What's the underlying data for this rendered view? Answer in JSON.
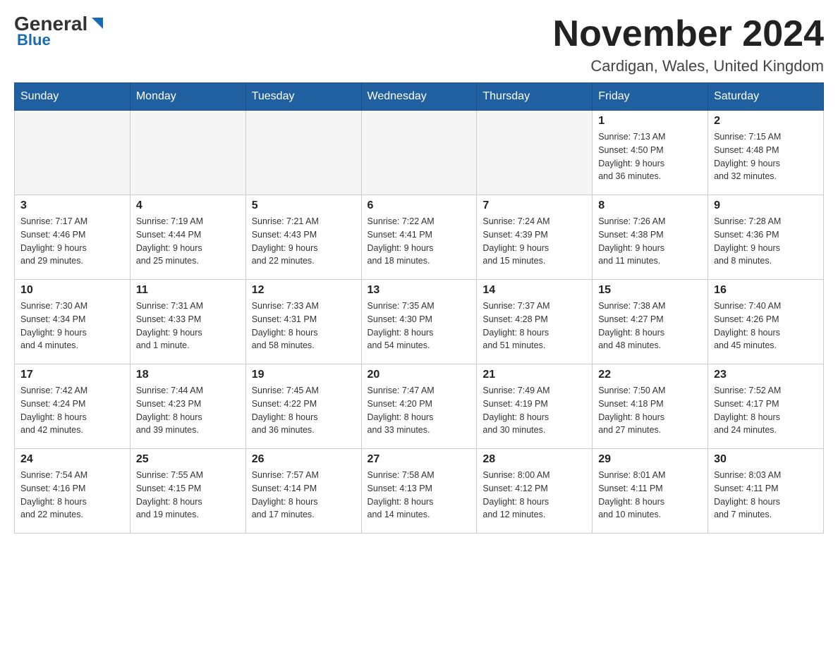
{
  "header": {
    "logo_general": "General",
    "logo_blue": "Blue",
    "month_title": "November 2024",
    "location": "Cardigan, Wales, United Kingdom"
  },
  "days_of_week": [
    "Sunday",
    "Monday",
    "Tuesday",
    "Wednesday",
    "Thursday",
    "Friday",
    "Saturday"
  ],
  "weeks": [
    {
      "days": [
        {
          "date": "",
          "info": ""
        },
        {
          "date": "",
          "info": ""
        },
        {
          "date": "",
          "info": ""
        },
        {
          "date": "",
          "info": ""
        },
        {
          "date": "",
          "info": ""
        },
        {
          "date": "1",
          "info": "Sunrise: 7:13 AM\nSunset: 4:50 PM\nDaylight: 9 hours\nand 36 minutes."
        },
        {
          "date": "2",
          "info": "Sunrise: 7:15 AM\nSunset: 4:48 PM\nDaylight: 9 hours\nand 32 minutes."
        }
      ]
    },
    {
      "days": [
        {
          "date": "3",
          "info": "Sunrise: 7:17 AM\nSunset: 4:46 PM\nDaylight: 9 hours\nand 29 minutes."
        },
        {
          "date": "4",
          "info": "Sunrise: 7:19 AM\nSunset: 4:44 PM\nDaylight: 9 hours\nand 25 minutes."
        },
        {
          "date": "5",
          "info": "Sunrise: 7:21 AM\nSunset: 4:43 PM\nDaylight: 9 hours\nand 22 minutes."
        },
        {
          "date": "6",
          "info": "Sunrise: 7:22 AM\nSunset: 4:41 PM\nDaylight: 9 hours\nand 18 minutes."
        },
        {
          "date": "7",
          "info": "Sunrise: 7:24 AM\nSunset: 4:39 PM\nDaylight: 9 hours\nand 15 minutes."
        },
        {
          "date": "8",
          "info": "Sunrise: 7:26 AM\nSunset: 4:38 PM\nDaylight: 9 hours\nand 11 minutes."
        },
        {
          "date": "9",
          "info": "Sunrise: 7:28 AM\nSunset: 4:36 PM\nDaylight: 9 hours\nand 8 minutes."
        }
      ]
    },
    {
      "days": [
        {
          "date": "10",
          "info": "Sunrise: 7:30 AM\nSunset: 4:34 PM\nDaylight: 9 hours\nand 4 minutes."
        },
        {
          "date": "11",
          "info": "Sunrise: 7:31 AM\nSunset: 4:33 PM\nDaylight: 9 hours\nand 1 minute."
        },
        {
          "date": "12",
          "info": "Sunrise: 7:33 AM\nSunset: 4:31 PM\nDaylight: 8 hours\nand 58 minutes."
        },
        {
          "date": "13",
          "info": "Sunrise: 7:35 AM\nSunset: 4:30 PM\nDaylight: 8 hours\nand 54 minutes."
        },
        {
          "date": "14",
          "info": "Sunrise: 7:37 AM\nSunset: 4:28 PM\nDaylight: 8 hours\nand 51 minutes."
        },
        {
          "date": "15",
          "info": "Sunrise: 7:38 AM\nSunset: 4:27 PM\nDaylight: 8 hours\nand 48 minutes."
        },
        {
          "date": "16",
          "info": "Sunrise: 7:40 AM\nSunset: 4:26 PM\nDaylight: 8 hours\nand 45 minutes."
        }
      ]
    },
    {
      "days": [
        {
          "date": "17",
          "info": "Sunrise: 7:42 AM\nSunset: 4:24 PM\nDaylight: 8 hours\nand 42 minutes."
        },
        {
          "date": "18",
          "info": "Sunrise: 7:44 AM\nSunset: 4:23 PM\nDaylight: 8 hours\nand 39 minutes."
        },
        {
          "date": "19",
          "info": "Sunrise: 7:45 AM\nSunset: 4:22 PM\nDaylight: 8 hours\nand 36 minutes."
        },
        {
          "date": "20",
          "info": "Sunrise: 7:47 AM\nSunset: 4:20 PM\nDaylight: 8 hours\nand 33 minutes."
        },
        {
          "date": "21",
          "info": "Sunrise: 7:49 AM\nSunset: 4:19 PM\nDaylight: 8 hours\nand 30 minutes."
        },
        {
          "date": "22",
          "info": "Sunrise: 7:50 AM\nSunset: 4:18 PM\nDaylight: 8 hours\nand 27 minutes."
        },
        {
          "date": "23",
          "info": "Sunrise: 7:52 AM\nSunset: 4:17 PM\nDaylight: 8 hours\nand 24 minutes."
        }
      ]
    },
    {
      "days": [
        {
          "date": "24",
          "info": "Sunrise: 7:54 AM\nSunset: 4:16 PM\nDaylight: 8 hours\nand 22 minutes."
        },
        {
          "date": "25",
          "info": "Sunrise: 7:55 AM\nSunset: 4:15 PM\nDaylight: 8 hours\nand 19 minutes."
        },
        {
          "date": "26",
          "info": "Sunrise: 7:57 AM\nSunset: 4:14 PM\nDaylight: 8 hours\nand 17 minutes."
        },
        {
          "date": "27",
          "info": "Sunrise: 7:58 AM\nSunset: 4:13 PM\nDaylight: 8 hours\nand 14 minutes."
        },
        {
          "date": "28",
          "info": "Sunrise: 8:00 AM\nSunset: 4:12 PM\nDaylight: 8 hours\nand 12 minutes."
        },
        {
          "date": "29",
          "info": "Sunrise: 8:01 AM\nSunset: 4:11 PM\nDaylight: 8 hours\nand 10 minutes."
        },
        {
          "date": "30",
          "info": "Sunrise: 8:03 AM\nSunset: 4:11 PM\nDaylight: 8 hours\nand 7 minutes."
        }
      ]
    }
  ]
}
